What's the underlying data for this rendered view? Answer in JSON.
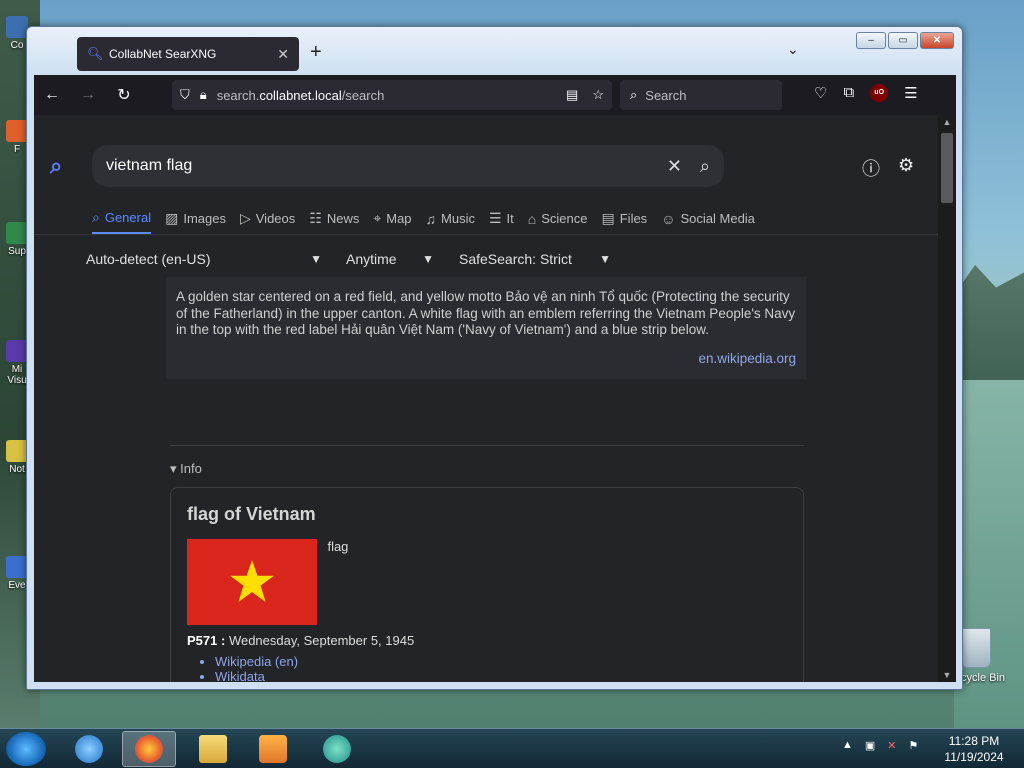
{
  "desktop": {
    "icons": [
      {
        "label": "Co"
      },
      {
        "label": "F"
      },
      {
        "label": "Sup"
      },
      {
        "label": "Mi Visu"
      },
      {
        "label": "Not"
      },
      {
        "label": "Eve"
      }
    ],
    "recycle_bin": "Recycle Bin"
  },
  "browser": {
    "tab_title": "CollabNet SearXNG",
    "url_prefix": "search.",
    "url_host": "collabnet.local",
    "url_path": "/search",
    "search_placeholder": "Search"
  },
  "page": {
    "query": "vietnam flag",
    "categories": [
      {
        "label": "General",
        "icon": "⌕",
        "active": true
      },
      {
        "label": "Images",
        "icon": "▨",
        "active": false
      },
      {
        "label": "Videos",
        "icon": "▷",
        "active": false
      },
      {
        "label": "News",
        "icon": "☷",
        "active": false
      },
      {
        "label": "Map",
        "icon": "⌖",
        "active": false
      },
      {
        "label": "Music",
        "icon": "♫",
        "active": false
      },
      {
        "label": "It",
        "icon": "☰",
        "active": false
      },
      {
        "label": "Science",
        "icon": "⌂",
        "active": false
      },
      {
        "label": "Files",
        "icon": "▤",
        "active": false
      },
      {
        "label": "Social Media",
        "icon": "☺",
        "active": false
      }
    ],
    "filters": {
      "language": "Auto-detect (en-US)",
      "time": "Anytime",
      "safesearch": "SafeSearch: Strict"
    },
    "infobox_text": "A golden star centered on a red field, and yellow motto Bảo vệ an ninh Tổ quốc (Protecting the security of the Fatherland) in the upper canton. A white flag with an emblem referring the Vietnam People's Navy in the top with the red label Hải quân Việt Nam ('Navy of Vietnam') and a blue strip below.",
    "infobox_source": "en.wikipedia.org",
    "info_toggle": "▾ Info",
    "card": {
      "title": "flag of Vietnam",
      "image_caption": "flag",
      "p571_label": "P571 :",
      "p571_value": "Wednesday, September 5, 1945",
      "links": [
        "Wikipedia (en)",
        "Wikidata"
      ]
    }
  },
  "taskbar": {
    "time": "11:28 PM",
    "date": "11/19/2024"
  }
}
